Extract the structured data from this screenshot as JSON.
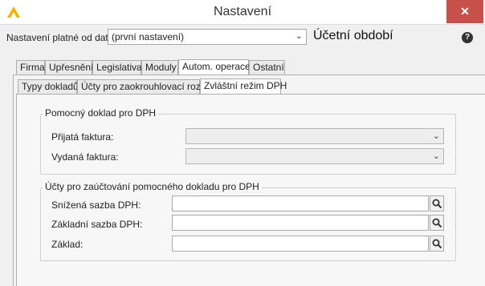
{
  "window": {
    "title": "Nastavení",
    "close_glyph": "✕"
  },
  "header": {
    "date_label": "Nastavení platné od data:",
    "date_value": "(první nastavení)",
    "section_title": "Účetní období",
    "help_glyph": "?"
  },
  "tabs": [
    {
      "label": "Firma"
    },
    {
      "label": "Upřesnění"
    },
    {
      "label": "Legislativa"
    },
    {
      "label": "Moduly"
    },
    {
      "label": "Autom. operace",
      "active": true
    },
    {
      "label": "Ostatní"
    }
  ],
  "subtabs": [
    {
      "label": "Typy dokladů"
    },
    {
      "label": "Účty pro zaokrouhlovací rozdíl"
    },
    {
      "label": "Zvláštní režim DPH",
      "active": true
    }
  ],
  "group1": {
    "title": "Pomocný doklad pro DPH",
    "prijata_label": "Přijatá faktura:",
    "prijata_value": "",
    "vydana_label": "Vydaná faktura:",
    "vydana_value": ""
  },
  "group2": {
    "title": "Účty pro zaúčtování pomocného dokladu pro DPH",
    "snizena_label": "Snížená sazba DPH:",
    "snizena_value": "",
    "zakladni_label": "Základní sazba DPH:",
    "zakladni_value": "",
    "zaklad_label": "Základ:",
    "zaklad_value": ""
  },
  "icons": {
    "app": "app-logo-icon",
    "help": "help-icon",
    "search": "magnifier-icon",
    "chevron": "chevron-down-icon"
  },
  "colors": {
    "close_button": "#c7504a",
    "logo": "#f2b400"
  }
}
